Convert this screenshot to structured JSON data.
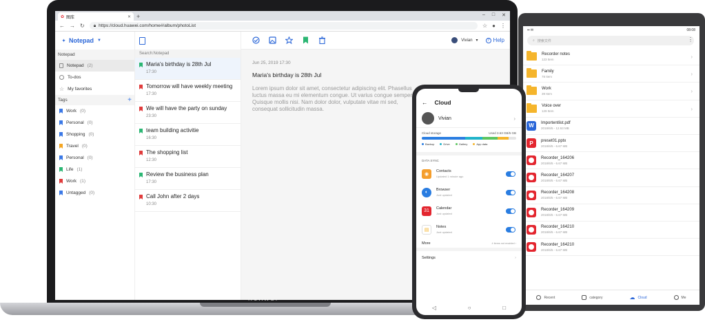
{
  "laptop": {
    "brand": "HUAWEI",
    "browser": {
      "tab_title": "图库",
      "url": "https://cloud.huawei.com/home#/album/photoList",
      "new_tab": "+",
      "minimize": "–",
      "maximize": "□",
      "close": "✕"
    },
    "app": {
      "name": "Notepad",
      "section_notepad": "Notepad",
      "nav": [
        {
          "label": "Notepad",
          "count": "(2)"
        },
        {
          "label": "To-dos",
          "count": ""
        },
        {
          "label": "My favorites",
          "count": ""
        }
      ],
      "section_tags": "Tags",
      "add_tag": "+",
      "tags": [
        {
          "label": "Work",
          "count": "(0)",
          "color": "#3a78e6"
        },
        {
          "label": "Personal",
          "count": "(0)",
          "color": "#3a78e6"
        },
        {
          "label": "Shopping",
          "count": "(0)",
          "color": "#3a78e6"
        },
        {
          "label": "Travel",
          "count": "(0)",
          "color": "#f5a623"
        },
        {
          "label": "Personal",
          "count": "(0)",
          "color": "#3a78e6"
        },
        {
          "label": "Life",
          "count": "(1)",
          "color": "#2bb673"
        },
        {
          "label": "Work",
          "count": "(1)",
          "color": "#e03b3b"
        },
        {
          "label": "Untagged",
          "count": "(0)",
          "color": "#3a78e6"
        }
      ],
      "search_placeholder": "Search:Notepad",
      "notes": [
        {
          "title": "Maria's birthday is 28th Jul",
          "time": "17:30",
          "color": "#2bb673"
        },
        {
          "title": "Tomorrow will have weekly meeting",
          "time": "17:30",
          "color": "#e03b3b"
        },
        {
          "title": "We will have the party on sunday",
          "time": "23:30",
          "color": "#e03b3b"
        },
        {
          "title": "team building activitie",
          "time": "16:30",
          "color": "#2bb673"
        },
        {
          "title": "The shopping list",
          "time": "12:30",
          "color": "#e03b3b"
        },
        {
          "title": "Review the business plan",
          "time": "17:30",
          "color": "#2bb673"
        },
        {
          "title": "Call John after 2 days",
          "time": "10:30",
          "color": "#e03b3b"
        }
      ],
      "user_name": "Vivian",
      "help": "Help",
      "detail": {
        "date": "Jun 25, 2019 17:30",
        "title": "Maria's birthday is 28th Jul",
        "body": "Lorem ipsum dolor sit amet, consectetur adipiscing elit. Phasellus luctus massa eu mi elementum congue. Ut varius congue semper. Quisque mollis nisi. Nam dolor dolor, vulputate vitae mi sed, consequat sollicitudin massa."
      }
    }
  },
  "tablet": {
    "status_time": "08:08",
    "search_placeholder": "搜索文件",
    "files": [
      {
        "name": "Recorder notes",
        "sub": "123 Item",
        "type": "folder"
      },
      {
        "name": "Family",
        "sub": "78 Item",
        "type": "folder"
      },
      {
        "name": "Work",
        "sub": "39 Item",
        "type": "folder"
      },
      {
        "name": "Voice over",
        "sub": "129 Item",
        "type": "folder"
      },
      {
        "name": "Importentlist.pdf",
        "sub": "2018/6/5 - 12.53 MB",
        "type": "word",
        "icon": "W"
      },
      {
        "name": "preset01.pptx",
        "sub": "2018/6/5 - 6.67 MB",
        "type": "ppt",
        "icon": "P"
      },
      {
        "name": "Recorder_164206",
        "sub": "2018/6/5 - 6.67 MB",
        "type": "rec"
      },
      {
        "name": "Recorder_164207",
        "sub": "2018/6/5 - 6.67 MB",
        "type": "rec"
      },
      {
        "name": "Recorder_164208",
        "sub": "2018/6/5 - 6.67 MB",
        "type": "rec"
      },
      {
        "name": "Recorder_164209",
        "sub": "2018/6/5 - 6.67 MB",
        "type": "rec"
      },
      {
        "name": "Recorder_164210",
        "sub": "2018/6/5 - 6.67 MB",
        "type": "rec"
      },
      {
        "name": "Recorder_164210",
        "sub": "2018/6/5 - 6.67 MB",
        "type": "rec"
      }
    ],
    "nav": [
      "Recent",
      "category",
      "Cloud",
      "Me"
    ]
  },
  "phone": {
    "title": "Cloud",
    "user": "Vivian",
    "storage_label": "Cloud storage",
    "storage_used": "Used 3.63 GB/5 GB",
    "legend": [
      {
        "label": "Backup",
        "color": "#2a7de1"
      },
      {
        "label": "Drive",
        "color": "#20b3c9"
      },
      {
        "label": "Gallery",
        "color": "#5cc55f"
      },
      {
        "label": "App data",
        "color": "#f5b52c"
      }
    ],
    "storage_share": [
      0.46,
      0.18,
      0.16,
      0.12
    ],
    "section": "DATA SYNC",
    "sync": [
      {
        "name": "Contacts",
        "status": "Updated 1 minute ago",
        "color": "#f59e2c"
      },
      {
        "name": "Browser",
        "status": "Just updated",
        "color": "#2a7de1"
      },
      {
        "name": "Calendar",
        "status": "Just updated",
        "color": "#e3262f",
        "glyph": "31"
      },
      {
        "name": "Notes",
        "status": "Just updated",
        "color": "#f5b52c"
      }
    ],
    "more": "More",
    "more_status": "4 items not enabled",
    "settings": "Settings"
  }
}
